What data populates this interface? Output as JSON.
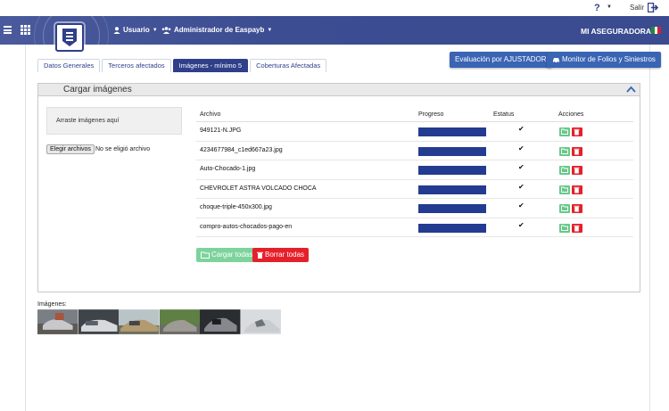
{
  "topbar": {
    "logout_label": "Salir"
  },
  "nav": {
    "user_menu": "Usuario",
    "admin_menu": "Administrador de Easpayb",
    "insurer": "MI ASEGURADORA"
  },
  "tabs": [
    {
      "label": "Datos Generales",
      "active": false
    },
    {
      "label": "Terceros afectados",
      "active": false
    },
    {
      "label": "Imágenes - mínimo 5",
      "active": true
    },
    {
      "label": "Coberturas Afectadas",
      "active": false
    }
  ],
  "actions": {
    "evaluation": "Evaluación por AJUSTADOR",
    "monitor": "Monitor de Folios y Siniestros"
  },
  "panel": {
    "title": "Cargar imágenes",
    "dropzone_text": "Arraste imágenes aquí",
    "choose_files": "Elegir archivos",
    "no_file": "No se eligió archivo",
    "columns": {
      "file": "Archivo",
      "progress": "Progreso",
      "status": "Estatus",
      "actions": "Acciones"
    },
    "files": [
      {
        "name": "949121-N.JPG",
        "progress": 1.0,
        "status": "✔"
      },
      {
        "name": "4234677984_c1ed667a23.jpg",
        "progress": 1.0,
        "status": "✔"
      },
      {
        "name": "Auto-Chocado-1.jpg",
        "progress": 1.0,
        "status": "✔"
      },
      {
        "name": "CHEVROLET ASTRA VOLCADO CHOCA",
        "progress": 1.0,
        "status": "✔"
      },
      {
        "name": "choque-triple-450x300.jpg",
        "progress": 1.0,
        "status": "✔"
      },
      {
        "name": "compro-autos-chocados-pago-en",
        "progress": 1.0,
        "status": "✔"
      }
    ],
    "upload_all": "Cargar todas",
    "delete_all": "Borrar todas"
  },
  "images_label": "Imágenes:",
  "colors": {
    "brand": "#2f3f8a",
    "progress": "#233b91",
    "upload": "#68c88a",
    "delete": "#e5202a",
    "action_button": "#3a64b4"
  },
  "icons": {
    "help": "help-icon",
    "logout": "logout-icon",
    "menu": "hamburger-icon",
    "apps": "apps-grid-icon",
    "user": "user-icon",
    "users": "users-icon",
    "flag": "mexico-flag-icon",
    "collapse": "chevron-up-icon",
    "upload": "upload-folder-icon",
    "delete": "trash-icon",
    "status": "check-icon"
  }
}
